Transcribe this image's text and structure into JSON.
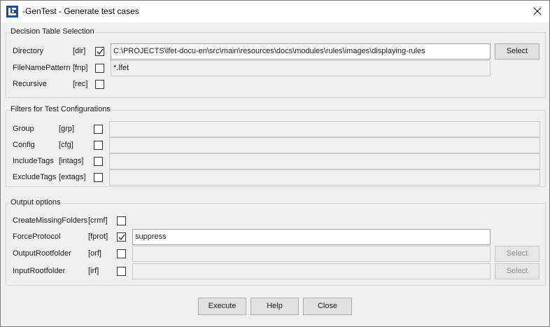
{
  "window": {
    "title": "-GenTest - Generate test cases"
  },
  "decision_table": {
    "legend": "Decision Table Selection",
    "rows": [
      {
        "label": "Directory",
        "code": "[dir]",
        "checked": true,
        "value": "C:\\PROJECTS\\lfet-docu-en\\src\\main\\resources\\docs\\modules\\rules\\images\\displaying-rules",
        "button": "Select"
      },
      {
        "label": "FileNamePattern",
        "code": "[fnp]",
        "checked": false,
        "value": "*.lfet"
      },
      {
        "label": "Recursive",
        "code": "[rec]",
        "checked": false
      }
    ]
  },
  "filters": {
    "legend": "Filters for Test Configurations",
    "rows": [
      {
        "label": "Group",
        "code": "[grp]",
        "checked": false,
        "value": ""
      },
      {
        "label": "Config",
        "code": "[cfg]",
        "checked": false,
        "value": ""
      },
      {
        "label": "IncludeTags",
        "code": "[intags]",
        "checked": false,
        "value": ""
      },
      {
        "label": "ExcludeTags",
        "code": "[extags]",
        "checked": false,
        "value": ""
      }
    ]
  },
  "output": {
    "legend": "Output options",
    "rows": [
      {
        "label": "CreateMissingFolders",
        "code": "[crmf]",
        "checked": false
      },
      {
        "label": "ForceProtocol",
        "code": "[fprot]",
        "checked": true,
        "value": "suppress"
      },
      {
        "label": "OutputRootfolder",
        "code": "[orf]",
        "checked": false,
        "value": "",
        "button": "Select"
      },
      {
        "label": "InputRootfolder",
        "code": "[irf]",
        "checked": false,
        "value": "",
        "button": "Select"
      }
    ]
  },
  "footer": {
    "execute": "Execute",
    "help": "Help",
    "close": "Close"
  }
}
